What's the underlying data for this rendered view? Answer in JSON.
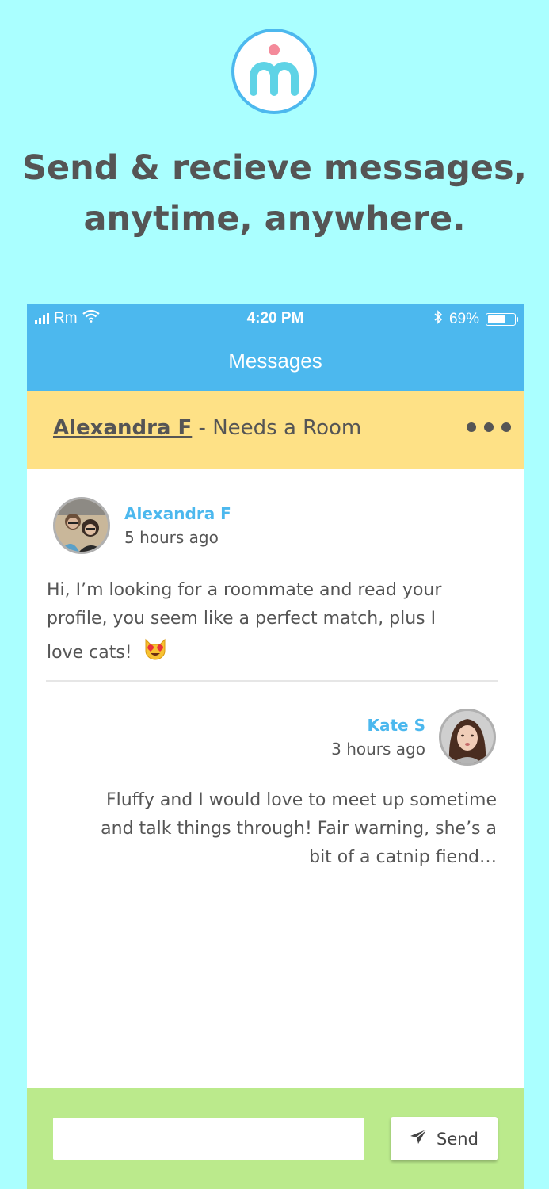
{
  "colors": {
    "page_background": "#aaffff",
    "header_blue": "#4cb8ee",
    "thread_yellow": "#fee186",
    "composer_green": "#bbea8c",
    "text_gray": "#555555",
    "logo_pink": "#f48a9a"
  },
  "headline": {
    "line1": "Send & recieve messages,",
    "line2": "anytime, anywhere."
  },
  "status_bar": {
    "carrier": "Rm",
    "time": "4:20 PM",
    "battery_percent": "69%",
    "battery_level": 0.69,
    "icons": [
      "signal-icon",
      "wifi-icon",
      "bluetooth-icon",
      "battery-icon"
    ]
  },
  "nav": {
    "title": "Messages"
  },
  "thread": {
    "name": "Alexandra F",
    "separator": " - ",
    "subject": "Needs a Room",
    "menu_icon": "more-dots-icon"
  },
  "messages": [
    {
      "author": "Alexandra F",
      "time": "5 hours ago",
      "lines": [
        "Hi, I’m looking for a roommate and read your",
        "profile, you seem like a perfect match, plus I",
        "love cats!"
      ],
      "emoji": "heart-eyes-cat-emoji"
    },
    {
      "author": "Kate S",
      "time": "3 hours ago",
      "lines": [
        "Fluffy and I would love to meet up sometime",
        "and talk things through! Fair warning, she’s a",
        "bit of a catnip fiend…"
      ]
    }
  ],
  "composer": {
    "input_value": "",
    "send_label": "Send",
    "send_icon": "paper-plane-icon"
  }
}
